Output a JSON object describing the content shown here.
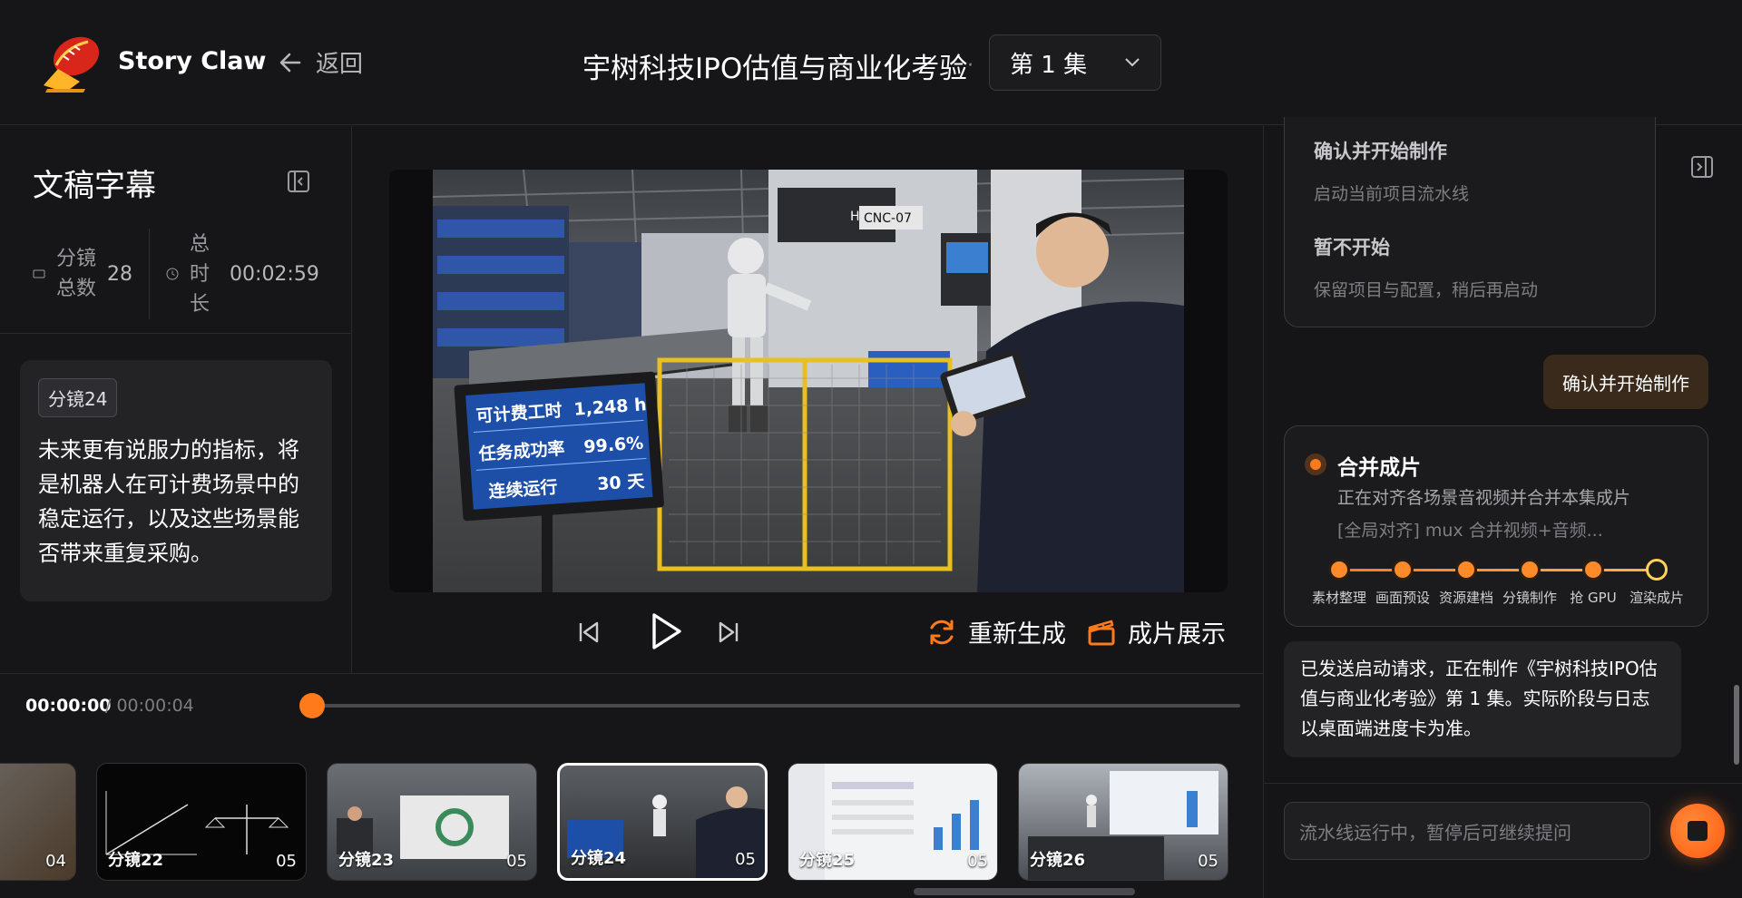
{
  "header": {
    "brand": "Story Claw",
    "back_label": "返回",
    "title": "宇树科技IPO估值与商业化考验",
    "separator": "·",
    "episode": "第 1 集"
  },
  "left": {
    "heading": "文稿字幕",
    "stats": {
      "shots_label": "分镜\n总数",
      "shots_value": "28",
      "duration_label": "总\n时\n长",
      "duration_value": "00:02:59"
    },
    "card": {
      "tag": "分镜24",
      "text": "未来更有说服力的指标，将是机器人在可计费场景中的稳定运行，以及这些场景能否带来重复采购。"
    }
  },
  "video": {
    "sign": {
      "line1_label": "可计费工时",
      "line1_value": "1,248 h",
      "line2_label": "任务成功率",
      "line2_value": "99.6%",
      "line3_label": "连续运行",
      "line3_value": "30 天"
    },
    "machine_label": "CNC-07",
    "machine_brand": "HAAS"
  },
  "controls": {
    "regenerate": "重新生成",
    "showcase": "成片展示"
  },
  "timeline": {
    "current": "00:00:00",
    "total": "/ 00:00:04",
    "progress": 0,
    "thumbs": [
      {
        "name": "",
        "dur": "04"
      },
      {
        "name": "分镜22",
        "dur": "05"
      },
      {
        "name": "分镜23",
        "dur": "05"
      },
      {
        "name": "分镜24",
        "dur": "05"
      },
      {
        "name": "分镜25",
        "dur": "05"
      },
      {
        "name": "分镜26",
        "dur": "05"
      }
    ]
  },
  "right": {
    "options": [
      {
        "title": "确认并开始制作",
        "desc": "启动当前项目流水线"
      },
      {
        "title": "暂不开始",
        "desc": "保留项目与配置，稍后再启动"
      }
    ],
    "user_message": "确认并开始制作",
    "progress": {
      "title": "合并成片",
      "subtitle": "正在对齐各场景音视频并合并本集成片",
      "log": "[全局对齐] mux 合并视频+音频...",
      "steps": [
        "素材整理",
        "画面预设",
        "资源建档",
        "分镜制作",
        "抢 GPU",
        "渲染成片"
      ]
    },
    "bot_message": "已发送启动请求，正在制作《宇树科技IPO估值与商业化考验》第 1 集。实际阶段与日志以桌面端进度卡为准。",
    "input_placeholder": "流水线运行中，暂停后可继续提问"
  },
  "colors": {
    "accent": "#ff7a1a",
    "bg": "#151517",
    "card": "#232326"
  }
}
